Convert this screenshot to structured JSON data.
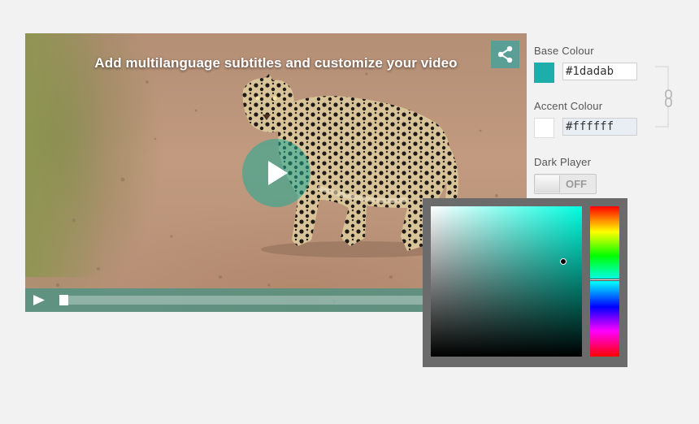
{
  "player": {
    "subtitle": "Add multilanguage subtitles and customize your video",
    "share_icon": "share-icon",
    "play_icon": "play-icon",
    "progress": 0.0
  },
  "settings": {
    "base_colour_label": "Base Colour",
    "base_colour_value": "#1dadab",
    "accent_colour_label": "Accent Colour",
    "accent_colour_value": "#ffffff",
    "dark_player_label": "Dark Player",
    "dark_player_state": "OFF",
    "link_icon": "link-icon"
  },
  "colors": {
    "base": "#1dadab",
    "accent": "#ffffff",
    "picker_hue": "#00ffe0"
  }
}
